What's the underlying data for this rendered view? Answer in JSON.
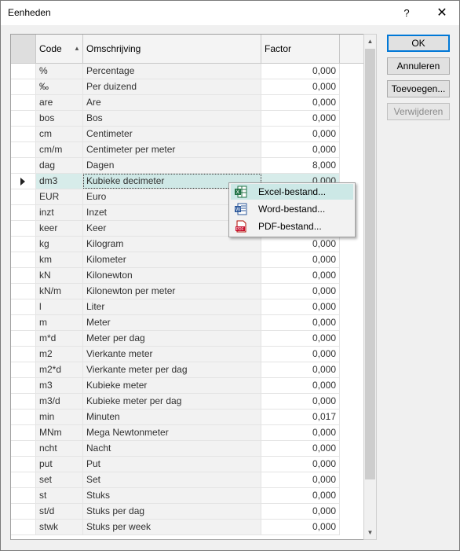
{
  "window": {
    "title": "Eenheden",
    "help": "?",
    "close": "✕"
  },
  "grid": {
    "columns": {
      "code": "Code",
      "omschrijving": "Omschrijving",
      "factor": "Factor"
    },
    "sort_indicator": "▲",
    "rows": [
      {
        "code": "%",
        "omschrijving": "Percentage",
        "factor": "0,000"
      },
      {
        "code": "‰",
        "omschrijving": "Per duizend",
        "factor": "0,000"
      },
      {
        "code": "are",
        "omschrijving": "Are",
        "factor": "0,000"
      },
      {
        "code": "bos",
        "omschrijving": "Bos",
        "factor": "0,000"
      },
      {
        "code": "cm",
        "omschrijving": "Centimeter",
        "factor": "0,000"
      },
      {
        "code": "cm/m",
        "omschrijving": "Centimeter per meter",
        "factor": "0,000"
      },
      {
        "code": "dag",
        "omschrijving": "Dagen",
        "factor": "8,000"
      },
      {
        "code": "dm3",
        "omschrijving": "Kubieke decimeter",
        "factor": "0,000",
        "current": true
      },
      {
        "code": "EUR",
        "omschrijving": "Euro",
        "factor": ""
      },
      {
        "code": "inzt",
        "omschrijving": "Inzet",
        "factor": ""
      },
      {
        "code": "keer",
        "omschrijving": "Keer",
        "factor": ""
      },
      {
        "code": "kg",
        "omschrijving": "Kilogram",
        "factor": "0,000"
      },
      {
        "code": "km",
        "omschrijving": "Kilometer",
        "factor": "0,000"
      },
      {
        "code": "kN",
        "omschrijving": "Kilonewton",
        "factor": "0,000"
      },
      {
        "code": "kN/m",
        "omschrijving": "Kilonewton per meter",
        "factor": "0,000"
      },
      {
        "code": "l",
        "omschrijving": "Liter",
        "factor": "0,000"
      },
      {
        "code": "m",
        "omschrijving": "Meter",
        "factor": "0,000"
      },
      {
        "code": "m*d",
        "omschrijving": "Meter per dag",
        "factor": "0,000"
      },
      {
        "code": "m2",
        "omschrijving": "Vierkante meter",
        "factor": "0,000"
      },
      {
        "code": "m2*d",
        "omschrijving": "Vierkante meter per dag",
        "factor": "0,000"
      },
      {
        "code": "m3",
        "omschrijving": "Kubieke meter",
        "factor": "0,000"
      },
      {
        "code": "m3/d",
        "omschrijving": "Kubieke meter per dag",
        "factor": "0,000"
      },
      {
        "code": "min",
        "omschrijving": "Minuten",
        "factor": "0,017"
      },
      {
        "code": "MNm",
        "omschrijving": "Mega Newtonmeter",
        "factor": "0,000"
      },
      {
        "code": "ncht",
        "omschrijving": "Nacht",
        "factor": "0,000"
      },
      {
        "code": "put",
        "omschrijving": "Put",
        "factor": "0,000"
      },
      {
        "code": "set",
        "omschrijving": "Set",
        "factor": "0,000"
      },
      {
        "code": "st",
        "omschrijving": "Stuks",
        "factor": "0,000"
      },
      {
        "code": "st/d",
        "omschrijving": "Stuks per dag",
        "factor": "0,000"
      },
      {
        "code": "stwk",
        "omschrijving": "Stuks per week",
        "factor": "0,000"
      }
    ]
  },
  "buttons": {
    "ok": "OK",
    "annuleren": "Annuleren",
    "toevoegen": "Toevoegen...",
    "verwijderen": "Verwijderen"
  },
  "context_menu": {
    "items": [
      {
        "label": "Excel-bestand...",
        "icon": "excel-icon",
        "highlighted": true
      },
      {
        "label": "Word-bestand...",
        "icon": "word-icon"
      },
      {
        "label": "PDF-bestand...",
        "icon": "pdf-icon"
      }
    ]
  },
  "colors": {
    "selection": "#cce8e6",
    "default_button_border": "#0078d7"
  }
}
